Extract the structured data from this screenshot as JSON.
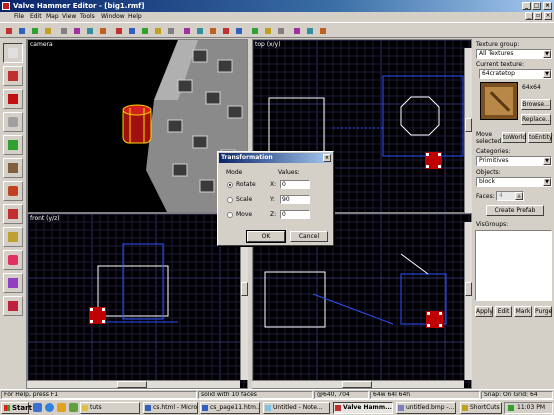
{
  "window": {
    "title": "Valve Hammer Editor - [big1.rmf]"
  },
  "menu": [
    "File",
    "Edit",
    "Map",
    "View",
    "Tools",
    "Window",
    "Help"
  ],
  "toolbar_icons": [
    "new-icon",
    "open-icon",
    "save-icon",
    "run-icon",
    "cut-icon",
    "copy-icon",
    "paste-icon",
    "undo-icon",
    "redo-icon",
    "grid-icon",
    "smaller-grid-icon",
    "larger-grid-icon",
    "3d-grid-icon",
    "group-icon",
    "ungroup-icon",
    "hide-icon",
    "carve-icon",
    "hollow-icon",
    "texture-lock-icon",
    "clip-icon",
    "vertex-icon",
    "entity-report-icon",
    "check-problems-icon",
    "radius-culling-icon"
  ],
  "tools": [
    "selection-tool",
    "magnify-tool",
    "camera-tool",
    "entity-tool",
    "block-tool",
    "texture-tool",
    "apply-texture-tool",
    "decal-tool",
    "clipping-tool",
    "vertex-tool",
    "path-tool",
    "overlay-tool"
  ],
  "viewports": {
    "camera": {
      "label": "camera"
    },
    "top": {
      "label": "top (x/y)"
    },
    "front": {
      "label": "front (y/z)"
    },
    "side": {
      "label": ""
    }
  },
  "right_panel": {
    "texture_group_label": "Texture group:",
    "texture_group_value": "All Textures",
    "current_texture_label": "Current texture:",
    "current_texture_value": "64cratetop",
    "texture_size": "64x64",
    "browse_button": "Browse...",
    "replace_button": "Replace...",
    "move_selected_label": "Move selected:",
    "to_world_button": "toWorld",
    "to_entity_button": "toEntity",
    "categories_label": "Categories:",
    "categories_value": "Primitives",
    "objects_label": "Objects:",
    "objects_value": "block",
    "faces_label": "Faces:",
    "faces_value": "4",
    "create_prefab_button": "Create Prefab",
    "visgroups_label": "VisGroups:",
    "apply_button": "Apply",
    "edit_button": "Edit",
    "mark_button": "Mark",
    "purge_button": "Purge"
  },
  "status": {
    "help": "For Help, press F1",
    "selection": "solid with 10 faces",
    "coords": "@640, 704",
    "size": "64w 64l 64h",
    "snap": "Snap: On Grid: 64"
  },
  "dialog": {
    "title": "Transformation",
    "mode_label": "Mode",
    "values_label": "Values:",
    "modes": [
      "Rotate",
      "Scale",
      "Move"
    ],
    "selected_mode": "Rotate",
    "x_label": "X:",
    "y_label": "Y:",
    "z_label": "Z:",
    "x_value": "0",
    "y_value": "90",
    "z_value": "0",
    "ok_button": "OK",
    "cancel_button": "Cancel"
  },
  "taskbar": {
    "start": "Start",
    "tasks": [
      {
        "label": "tuts",
        "active": false
      },
      {
        "label": "cs.html - Micros...",
        "active": false
      },
      {
        "label": "cs_page11.htm...",
        "active": false
      },
      {
        "label": "Untitled - Note...",
        "active": false
      },
      {
        "label": "Valve Hamm...",
        "active": true
      },
      {
        "label": "untitled.bmp -...",
        "active": false
      },
      {
        "label": "ShortCuts",
        "active": false
      }
    ],
    "clock": "11:03 PM"
  },
  "colors": {
    "titlebar_start": "#0a246a",
    "grid_fine": "#1a1a3a",
    "grid_major": "#303068",
    "selection_blue": "#3050ff",
    "brush_white": "#ffffff",
    "handle_red": "#c00000",
    "crate_yellow": "#ffd700"
  }
}
